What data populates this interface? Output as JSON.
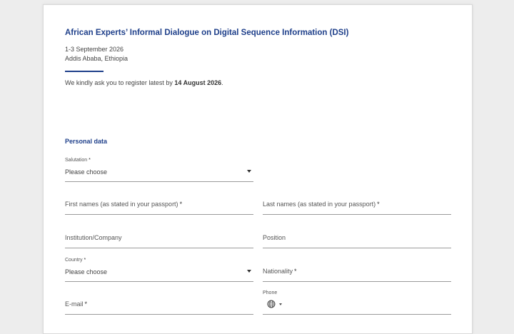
{
  "event": {
    "title": "African Experts’ Informal Dialogue on Digital Sequence Information (DSI)",
    "date": "1-3 September 2026",
    "place": "Addis Ababa, Ethiopia"
  },
  "notice": {
    "text": "We kindly ask you to register latest by ",
    "deadline": "14 August 2026",
    "end": "."
  },
  "section": {
    "personal_data": "Personal data"
  },
  "fields": {
    "salutation": {
      "label": "Salutation",
      "required": "*",
      "value": "Please choose"
    },
    "first_names": {
      "label": "First names (as stated in your passport)",
      "required": "*"
    },
    "last_names": {
      "label": "Last names (as stated in your passport)",
      "required": "*"
    },
    "institution": {
      "label": "Institution/Company"
    },
    "position": {
      "label": "Position"
    },
    "country": {
      "label": "Country",
      "required": "*",
      "value": "Please choose"
    },
    "nationality": {
      "label": "Nationality",
      "required": "*"
    },
    "email": {
      "label": "E-mail",
      "required": "*"
    },
    "phone": {
      "label": "Phone"
    }
  },
  "colors": {
    "accent": "#1e3f8a",
    "background": "#ededed"
  },
  "icons": {
    "phone_country": "globe-icon"
  }
}
